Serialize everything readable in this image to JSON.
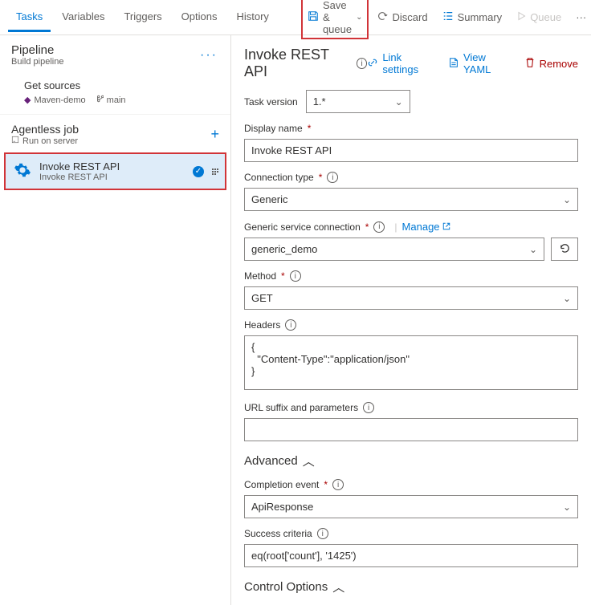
{
  "topTabs": [
    "Tasks",
    "Variables",
    "Triggers",
    "Options",
    "History"
  ],
  "activeTopTab": 0,
  "toolbar": {
    "saveQueue": "Save & queue",
    "discard": "Discard",
    "summary": "Summary",
    "queue": "Queue"
  },
  "pipeline": {
    "title": "Pipeline",
    "subtitle": "Build pipeline",
    "getSources": "Get sources",
    "repo": "Maven-demo",
    "branch": "main",
    "job": "Agentless job",
    "jobSub": "Run on server"
  },
  "task": {
    "title": "Invoke REST API",
    "subtitle": "Invoke REST API"
  },
  "formHeader": {
    "title": "Invoke REST API",
    "linkSettings": "Link settings",
    "viewYaml": "View YAML",
    "remove": "Remove"
  },
  "fields": {
    "taskVersionLabel": "Task version",
    "taskVersionValue": "1.*",
    "displayNameLabel": "Display name",
    "displayNameValue": "Invoke REST API",
    "connTypeLabel": "Connection type",
    "connTypeValue": "Generic",
    "serviceConnLabel": "Generic service connection",
    "serviceConnValue": "generic_demo",
    "manageLink": "Manage",
    "methodLabel": "Method",
    "methodValue": "GET",
    "headersLabel": "Headers",
    "headersValue": "{\n  \"Content-Type\":\"application/json\"\n}",
    "urlSuffixLabel": "URL suffix and parameters",
    "urlSuffixValue": "",
    "advanced": "Advanced",
    "completionLabel": "Completion event",
    "completionValue": "ApiResponse",
    "successLabel": "Success criteria",
    "successValue": "eq(root['count'], '1425')",
    "controlOptions": "Control Options"
  }
}
